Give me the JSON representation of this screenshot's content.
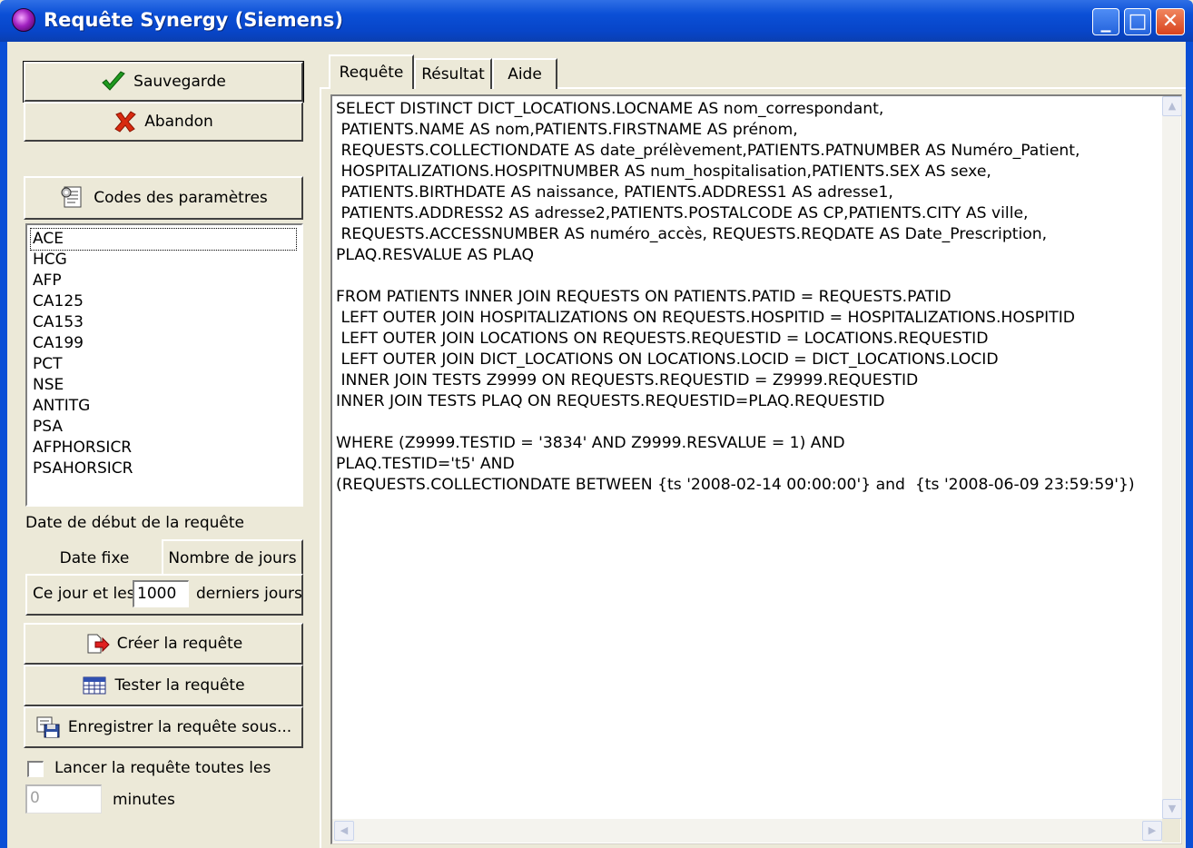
{
  "window": {
    "title": "Requête Synergy (Siemens)",
    "minimize_glyph": "_",
    "maximize_glyph": "□",
    "close_glyph": "✕"
  },
  "left": {
    "save_label": "Sauvegarde",
    "cancel_label": "Abandon",
    "param_codes_label": "Codes des paramètres",
    "params": [
      "ACE",
      "HCG",
      "AFP",
      "CA125",
      "CA153",
      "CA199",
      "PCT",
      "NSE",
      "ANTITG",
      "PSA",
      "AFPHORSICR",
      "PSAHORSICR"
    ],
    "start_date_label": "Date de début de la requête",
    "tab_fixed": "Date fixe",
    "tab_days": "Nombre de jours",
    "days_prefix": "Ce jour et les",
    "days_value": "1000",
    "days_suffix": "derniers jours",
    "create_label": "Créer la requête",
    "test_label": "Tester la requête",
    "save_as_label": "Enregistrer la requête sous...",
    "schedule_label": "Lancer la requête toutes les",
    "minutes_value": "0",
    "minutes_label": "minutes"
  },
  "tabs": [
    "Requête",
    "Résultat",
    "Aide"
  ],
  "sql": [
    "SELECT DISTINCT DICT_LOCATIONS.LOCNAME AS nom_correspondant,",
    " PATIENTS.NAME AS nom,PATIENTS.FIRSTNAME AS prénom,",
    " REQUESTS.COLLECTIONDATE AS date_prélèvement,PATIENTS.PATNUMBER AS Numéro_Patient,",
    " HOSPITALIZATIONS.HOSPITNUMBER AS num_hospitalisation,PATIENTS.SEX AS sexe,",
    " PATIENTS.BIRTHDATE AS naissance, PATIENTS.ADDRESS1 AS adresse1,",
    " PATIENTS.ADDRESS2 AS adresse2,PATIENTS.POSTALCODE AS CP,PATIENTS.CITY AS ville,",
    " REQUESTS.ACCESSNUMBER AS numéro_accès, REQUESTS.REQDATE AS Date_Prescription,",
    "PLAQ.RESVALUE AS PLAQ",
    "",
    "FROM PATIENTS INNER JOIN REQUESTS ON PATIENTS.PATID = REQUESTS.PATID",
    " LEFT OUTER JOIN HOSPITALIZATIONS ON REQUESTS.HOSPITID = HOSPITALIZATIONS.HOSPITID",
    " LEFT OUTER JOIN LOCATIONS ON REQUESTS.REQUESTID = LOCATIONS.REQUESTID",
    " LEFT OUTER JOIN DICT_LOCATIONS ON LOCATIONS.LOCID = DICT_LOCATIONS.LOCID",
    " INNER JOIN TESTS Z9999 ON REQUESTS.REQUESTID = Z9999.REQUESTID",
    "INNER JOIN TESTS PLAQ ON REQUESTS.REQUESTID=PLAQ.REQUESTID",
    "",
    "WHERE (Z9999.TESTID = '3834' AND Z9999.RESVALUE = 1) AND",
    "PLAQ.TESTID='t5' AND",
    "(REQUESTS.COLLECTIONDATE BETWEEN {ts '2008-02-14 00:00:00'} and  {ts '2008-06-09 23:59:59'})"
  ]
}
